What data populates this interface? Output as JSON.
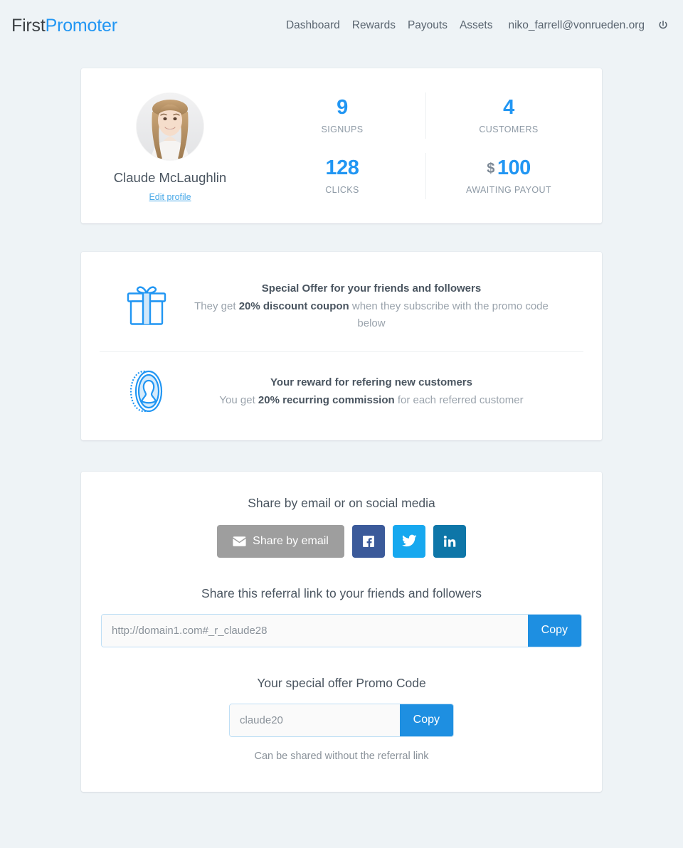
{
  "header": {
    "logo_first": "First",
    "logo_second": "Promoter",
    "nav": [
      {
        "label": "Dashboard"
      },
      {
        "label": "Rewards"
      },
      {
        "label": "Payouts"
      },
      {
        "label": "Assets"
      }
    ],
    "user_email": "niko_farrell@vonrueden.org",
    "logout_icon": "power-icon"
  },
  "profile": {
    "name": "Claude McLaughlin",
    "edit_link": "Edit profile",
    "avatar_icon": "avatar-photo"
  },
  "stats": [
    {
      "value": "9",
      "label": "SIGNUPS",
      "currency": ""
    },
    {
      "value": "4",
      "label": "CUSTOMERS",
      "currency": ""
    },
    {
      "value": "128",
      "label": "CLICKS",
      "currency": ""
    },
    {
      "value": "100",
      "label": "AWAITING PAYOUT",
      "currency": "$"
    }
  ],
  "offers": {
    "friends": {
      "icon": "gift-icon",
      "title": "Special Offer for your friends and followers",
      "sub_prefix": "They get ",
      "sub_bold": "20% discount coupon",
      "sub_suffix": " when they subscribe with the promo code below"
    },
    "reward": {
      "icon": "coin-icon",
      "title": "Your reward for refering new customers",
      "sub_prefix": "You get ",
      "sub_bold": "20% recurring commission",
      "sub_suffix": " for each referred customer"
    }
  },
  "share": {
    "heading": "Share by email or on social media",
    "email_button": "Share by email",
    "social": [
      {
        "name": "facebook",
        "icon": "facebook-icon",
        "color": "#3b5a9a"
      },
      {
        "name": "twitter",
        "icon": "twitter-icon",
        "color": "#17a8ef"
      },
      {
        "name": "linkedin",
        "icon": "linkedin-icon",
        "color": "#0e76a8"
      }
    ],
    "referral_heading": "Share this referral link to your friends and followers",
    "referral_value": "http://domain1.com#_r_claude28",
    "referral_copy": "Copy",
    "promo_heading": "Your special offer Promo Code",
    "promo_value": "claude20",
    "promo_copy": "Copy",
    "promo_note": "Can be shared without the referral link"
  },
  "colors": {
    "accent_blue": "#2196f3",
    "copy_blue": "#1e8fe1",
    "email_gray": "#9e9e9e",
    "page_bg": "#eef3f6"
  }
}
